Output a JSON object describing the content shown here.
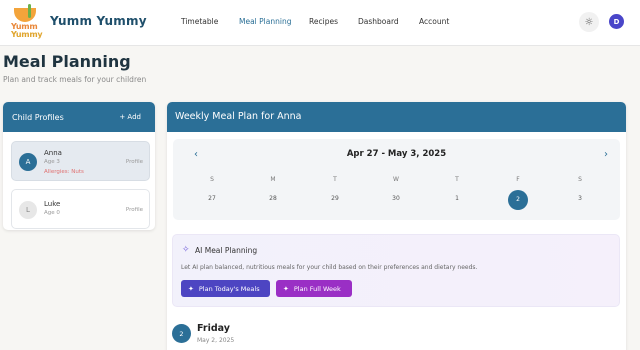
{
  "app": {
    "logo_line1": "Yumm",
    "logo_line2": "Yummy",
    "brand": "Yumm Yummy"
  },
  "nav": [
    {
      "label": "Timetable",
      "active": false
    },
    {
      "label": "Meal Planning",
      "active": true
    },
    {
      "label": "Recipes",
      "active": false
    },
    {
      "label": "Dashboard",
      "active": false
    },
    {
      "label": "Account",
      "active": false
    }
  ],
  "user": {
    "avatar_initial": "D"
  },
  "icons": {
    "theme": "sun-icon",
    "sparkle": "sparkle-icon",
    "prev": "chevron-left-icon",
    "next": "chevron-right-icon"
  },
  "colors": {
    "primary": "#2b6f97",
    "ai_today": "#4d45c2",
    "ai_week": "#9a2fc5",
    "allergy": "#e07070"
  },
  "page": {
    "title": "Meal Planning",
    "subtitle": "Plan and track meals for your children"
  },
  "profiles": {
    "title": "Child Profiles",
    "add_label": "+ Add",
    "children": [
      {
        "initial": "A",
        "name": "Anna",
        "age": "Age 3",
        "allergy": "Allergies: Nuts",
        "profile_label": "Profile",
        "selected": true
      },
      {
        "initial": "L",
        "name": "Luke",
        "age": "Age 0",
        "allergy": "",
        "profile_label": "Profile",
        "selected": false
      }
    ]
  },
  "weekly": {
    "title": "Weekly Meal Plan for Anna",
    "range": "Apr 27 - May 3, 2025",
    "days_of_week": [
      "S",
      "M",
      "T",
      "W",
      "T",
      "F",
      "S"
    ],
    "dates": [
      "27",
      "28",
      "29",
      "30",
      "1",
      "2",
      "3"
    ],
    "selected_index": 5
  },
  "ai": {
    "title": "AI Meal Planning",
    "description": "Let AI plan balanced, nutritious meals for your child based on their preferences and dietary needs.",
    "btn_today": "Plan Today's Meals",
    "btn_week": "Plan Full Week"
  },
  "day": {
    "number": "2",
    "name": "Friday",
    "date": "May 2, 2025"
  }
}
